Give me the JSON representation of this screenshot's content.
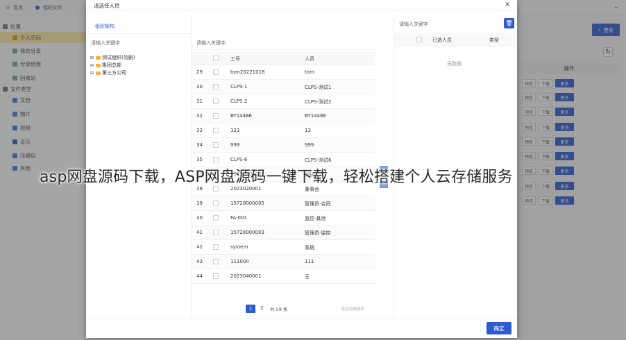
{
  "topbar": {
    "tabs": [
      "首页",
      "我的文件"
    ]
  },
  "sidebar": {
    "items": [
      {
        "label": "位置",
        "active": false,
        "level": 0
      },
      {
        "label": "个人空间",
        "active": true,
        "level": 1
      },
      {
        "label": "我的分享",
        "active": false,
        "level": 1
      },
      {
        "label": "分享给我",
        "active": false,
        "level": 1
      },
      {
        "label": "回收站",
        "active": false,
        "level": 1
      },
      {
        "label": "文件类型",
        "active": false,
        "level": 0
      },
      {
        "label": "文档",
        "active": false,
        "level": 1
      },
      {
        "label": "图片",
        "active": false,
        "level": 1
      },
      {
        "label": "视频",
        "active": false,
        "level": 1
      },
      {
        "label": "音乐",
        "active": false,
        "level": 1
      },
      {
        "label": "压缩包",
        "active": false,
        "level": 1
      },
      {
        "label": "其他",
        "active": false,
        "level": 1
      }
    ]
  },
  "background": {
    "search_label": "搜索",
    "ops_header": "操作",
    "op_buttons": [
      "预览",
      "下载",
      "更多"
    ]
  },
  "modal": {
    "title": "请选择人员",
    "org_tab": "组织架构",
    "left_keyword_placeholder": "请输入关键字",
    "mid_keyword_placeholder": "请输入关键字",
    "right_keyword_placeholder": "请输入关键字",
    "tree": [
      "测试组织(勿删)",
      "集团总部",
      "第三方公司"
    ],
    "table_headers": {
      "id": "工号",
      "name": "人员"
    },
    "rows": [
      {
        "no": "29",
        "id": "tom20221018",
        "name": "tom"
      },
      {
        "no": "30",
        "id": "CLPS-1",
        "name": "CLPS-测试1"
      },
      {
        "no": "31",
        "id": "CLPS-2",
        "name": "CLPS-测试2"
      },
      {
        "no": "32",
        "id": "BY14486",
        "name": "BY14486"
      },
      {
        "no": "33",
        "id": "123",
        "name": "13"
      },
      {
        "no": "34",
        "id": "999",
        "name": "999"
      },
      {
        "no": "35",
        "id": "CLPS-6",
        "name": "CLPS-测试6"
      },
      {
        "no": "37",
        "id": "15728000009",
        "name": "测试人员"
      },
      {
        "no": "38",
        "id": "2023020001",
        "name": "董事会"
      },
      {
        "no": "39",
        "id": "15728000005",
        "name": "管理员-合同"
      },
      {
        "no": "40",
        "id": "FA-001",
        "name": "监控-其他"
      },
      {
        "no": "41",
        "id": "15728000003",
        "name": "管理员-监控"
      },
      {
        "no": "42",
        "id": "system",
        "name": "系统"
      },
      {
        "no": "43",
        "id": "111000",
        "name": "111"
      },
      {
        "no": "44",
        "id": "2023040001",
        "name": "王"
      }
    ],
    "pager": {
      "current": "1",
      "next": "2",
      "total": "共 59 条",
      "note": "社区免费版本"
    },
    "selected_headers": {
      "name": "已选人员",
      "type": "类型"
    },
    "empty_text": "无数据",
    "confirm_label": "确定",
    "close_symbol": "×"
  },
  "watermark": "asp网盘源码下载，ASP网盘源码一键下载，轻松搭建个人云存储服务"
}
